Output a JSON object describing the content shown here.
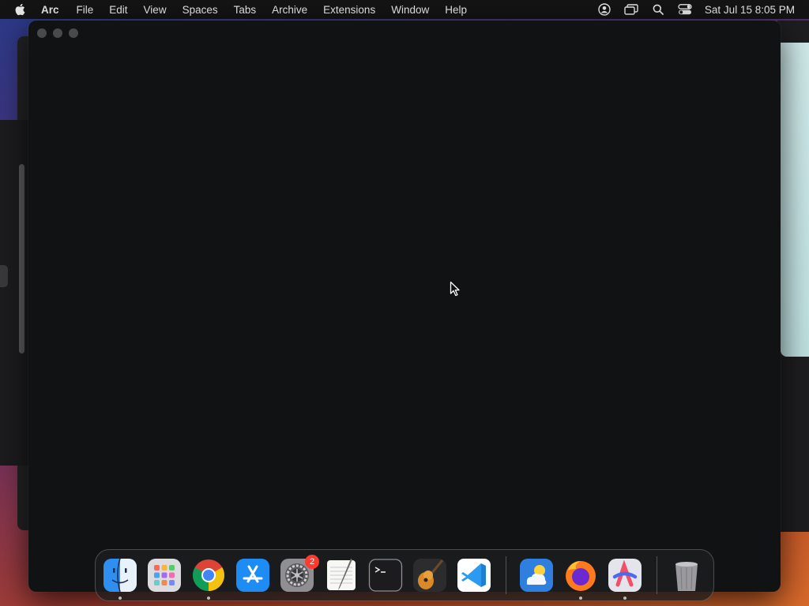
{
  "menubar": {
    "apple_icon": "apple-logo-icon",
    "app_name": "Arc",
    "items": [
      "File",
      "Edit",
      "View",
      "Spaces",
      "Tabs",
      "Archive",
      "Extensions",
      "Window",
      "Help"
    ],
    "status_icons": [
      "user-account-icon",
      "screen-mirroring-icon",
      "spotlight-search-icon",
      "control-center-icon"
    ],
    "clock": "Sat Jul 15  8:05 PM"
  },
  "dock": {
    "apps": [
      {
        "name": "Finder",
        "icon": "finder-icon",
        "running": true
      },
      {
        "name": "Launchpad",
        "icon": "launchpad-icon",
        "running": false
      },
      {
        "name": "Google Chrome",
        "icon": "chrome-icon",
        "running": true
      },
      {
        "name": "App Store",
        "icon": "app-store-icon",
        "running": false
      },
      {
        "name": "System Settings",
        "icon": "system-settings-icon",
        "running": false,
        "badge": "2"
      },
      {
        "name": "TextEdit",
        "icon": "textedit-icon",
        "running": false
      },
      {
        "name": "Terminal",
        "icon": "terminal-icon",
        "running": false
      },
      {
        "name": "GarageBand",
        "icon": "garageband-icon",
        "running": false
      },
      {
        "name": "Visual Studio Code",
        "icon": "vscode-icon",
        "running": false
      }
    ],
    "recent_apps": [
      {
        "name": "Weather",
        "icon": "weather-icon",
        "running": false
      },
      {
        "name": "Firefox",
        "icon": "firefox-icon",
        "running": true
      },
      {
        "name": "Arc",
        "icon": "arc-icon",
        "running": true
      }
    ],
    "trash_icon": "trash-icon"
  },
  "colors": {
    "menubar_bg": "#141414",
    "window_bg": "#111214",
    "badge": "#ff3b30"
  }
}
